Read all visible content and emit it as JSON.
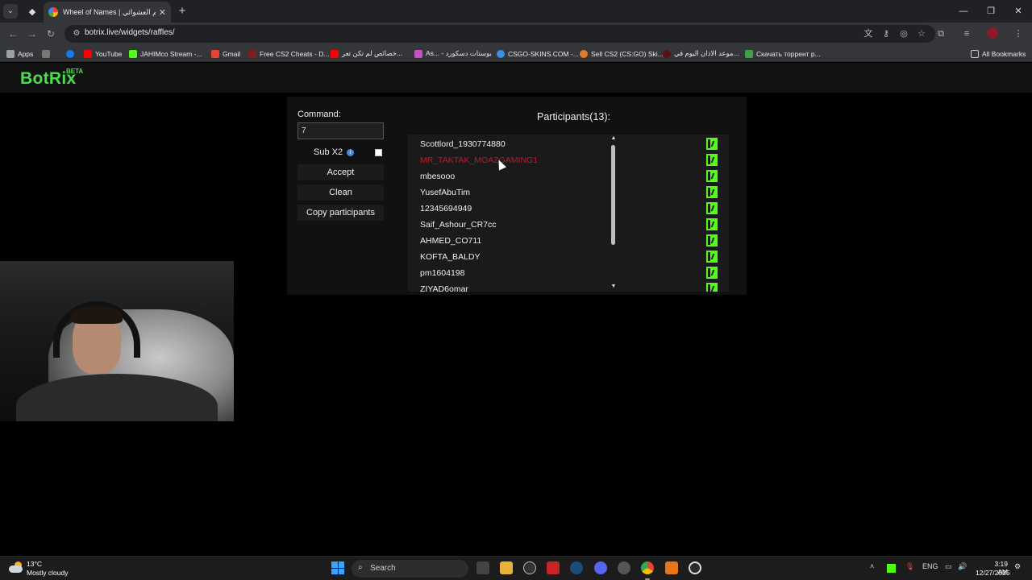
{
  "browser": {
    "tab": {
      "title": "Wheel of Names | اسم العشوائي",
      "close": "✕"
    },
    "new_tab": "+",
    "window": {
      "minimize": "—",
      "restore": "❐",
      "close": "✕"
    },
    "url": "botrix.live/widgets/raffles/",
    "bookmarks": [
      {
        "label": "Apps",
        "icon_color": "#9aa0a6"
      },
      {
        "label": "",
        "icon_color": "#1877f2"
      },
      {
        "label": "YouTube",
        "icon_color": "#ff0000"
      },
      {
        "label": "JAHIMco Stream -...",
        "icon_color": "#53fc18"
      },
      {
        "label": "Gmail",
        "icon_color": "#ea4335"
      },
      {
        "label": "Free CS2 Cheats - D...",
        "icon_color": "#7b1f1f"
      },
      {
        "label": "خصائص لم تكن تعر...",
        "icon_color": "#ff0000"
      },
      {
        "label": "As... - بوستات دسكورد",
        "icon_color": "#c850c0"
      },
      {
        "label": "CSGO-SKINS.COM -...",
        "icon_color": "#3a8ee6"
      },
      {
        "label": "Sell CS2 (CS:GO) Ski...",
        "icon_color": "#e07b2c"
      },
      {
        "label": "موعد الاذان اليوم في...",
        "icon_color": "#5a1010"
      },
      {
        "label": "Скачать торрент р...",
        "icon_color": "#3aa34a"
      }
    ],
    "all_bookmarks": "All Bookmarks"
  },
  "app": {
    "logo": "BotRix",
    "logo_badge": "BETA"
  },
  "raffle": {
    "command_label": "Command:",
    "command_value": "7",
    "sub_label": "Sub X2",
    "sub_info": "i",
    "sub_checked": false,
    "buttons": {
      "accept": "Accept",
      "clean": "Clean",
      "copy": "Copy participants"
    },
    "participants_title": "Participants(13):",
    "participants": [
      {
        "name": "Scottlord_1930774880",
        "highlighted": false
      },
      {
        "name": "MR_TAKTAK_MOAZGAMING1",
        "highlighted": true
      },
      {
        "name": "mbesooo",
        "highlighted": false
      },
      {
        "name": "YusefAbuTim",
        "highlighted": false
      },
      {
        "name": "12345694949",
        "highlighted": false
      },
      {
        "name": "Saif_Ashour_CR7cc",
        "highlighted": false
      },
      {
        "name": "AHMED_CO711",
        "highlighted": false
      },
      {
        "name": "KOFTA_BALDY",
        "highlighted": false
      },
      {
        "name": "pm1604198",
        "highlighted": false
      },
      {
        "name": "ZIYAD6omar",
        "highlighted": false
      }
    ],
    "platform_icon": "kick-icon",
    "accent_color": "#53fc18",
    "highlight_color": "#c0182c"
  },
  "taskbar": {
    "weather_temp": "13°C",
    "weather_desc": "Mostly cloudy",
    "search": "Search",
    "language": "ENG",
    "time": "3:19 AM",
    "date": "12/27/2025"
  }
}
